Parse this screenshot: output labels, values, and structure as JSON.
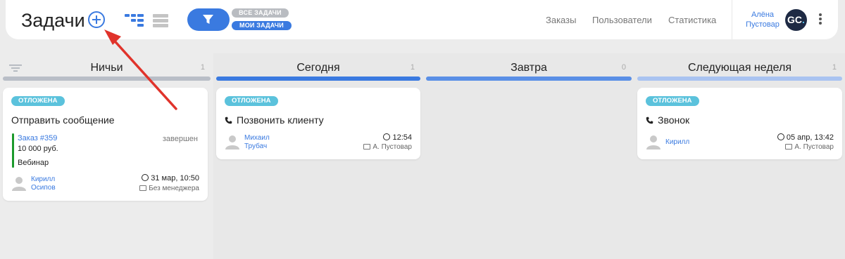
{
  "header": {
    "title": "Задачи",
    "filter_pills": {
      "all": "ВСЕ ЗАДАЧИ",
      "mine": "МОИ ЗАДАЧИ"
    },
    "nav": {
      "orders": "Заказы",
      "users": "Пользователи",
      "stats": "Статистика"
    },
    "user": {
      "first_name": "Алёна",
      "last_name": "Пустовар",
      "logo_letters": "GC",
      "logo_dot": "."
    }
  },
  "columns": [
    {
      "title": "Ничьи",
      "count": "1",
      "bar_color": "#b9bec7"
    },
    {
      "title": "Сегодня",
      "count": "1",
      "bar_color": "#3a7ae0"
    },
    {
      "title": "Завтра",
      "count": "0",
      "bar_color": "#5a8fe6"
    },
    {
      "title": "Следующая неделя",
      "count": "1",
      "bar_color": "#a9c3f1"
    }
  ],
  "cards": [
    {
      "badge": "ОТЛОЖЕНА",
      "title": "Отправить сообщение",
      "order": {
        "link": "Заказ #359",
        "sum": "10 000 руб.",
        "source": "Вебинар",
        "status": "завершен"
      },
      "person": {
        "line1": "Кирилл",
        "line2": "Осипов"
      },
      "due": "31 мар, 10:50",
      "manager": "Без менеджера"
    },
    {
      "badge": "ОТЛОЖЕНА",
      "title": "Позвонить клиенту",
      "person": {
        "line1": "Михаил",
        "line2": "Трубач"
      },
      "due": "12:54",
      "manager": "А. Пустовар"
    },
    {
      "badge": "ОТЛОЖЕНА",
      "title": "Звонок",
      "person": {
        "line1": "Кирилл",
        "line2": ""
      },
      "due": "05 апр, 13:42",
      "manager": "А. Пустовар"
    }
  ],
  "colors": {
    "accent": "#3a7ae0",
    "badge": "#5bc2dc",
    "order_strip": "#1c9a2c",
    "annotation_arrow": "#e0332b"
  },
  "icons": [
    "plus-circle-icon",
    "kanban-view-icon",
    "list-view-icon",
    "filter-icon",
    "sort-icon",
    "phone-icon",
    "clock-icon",
    "briefcase-icon",
    "user-avatar-icon",
    "kebab-menu-icon"
  ]
}
